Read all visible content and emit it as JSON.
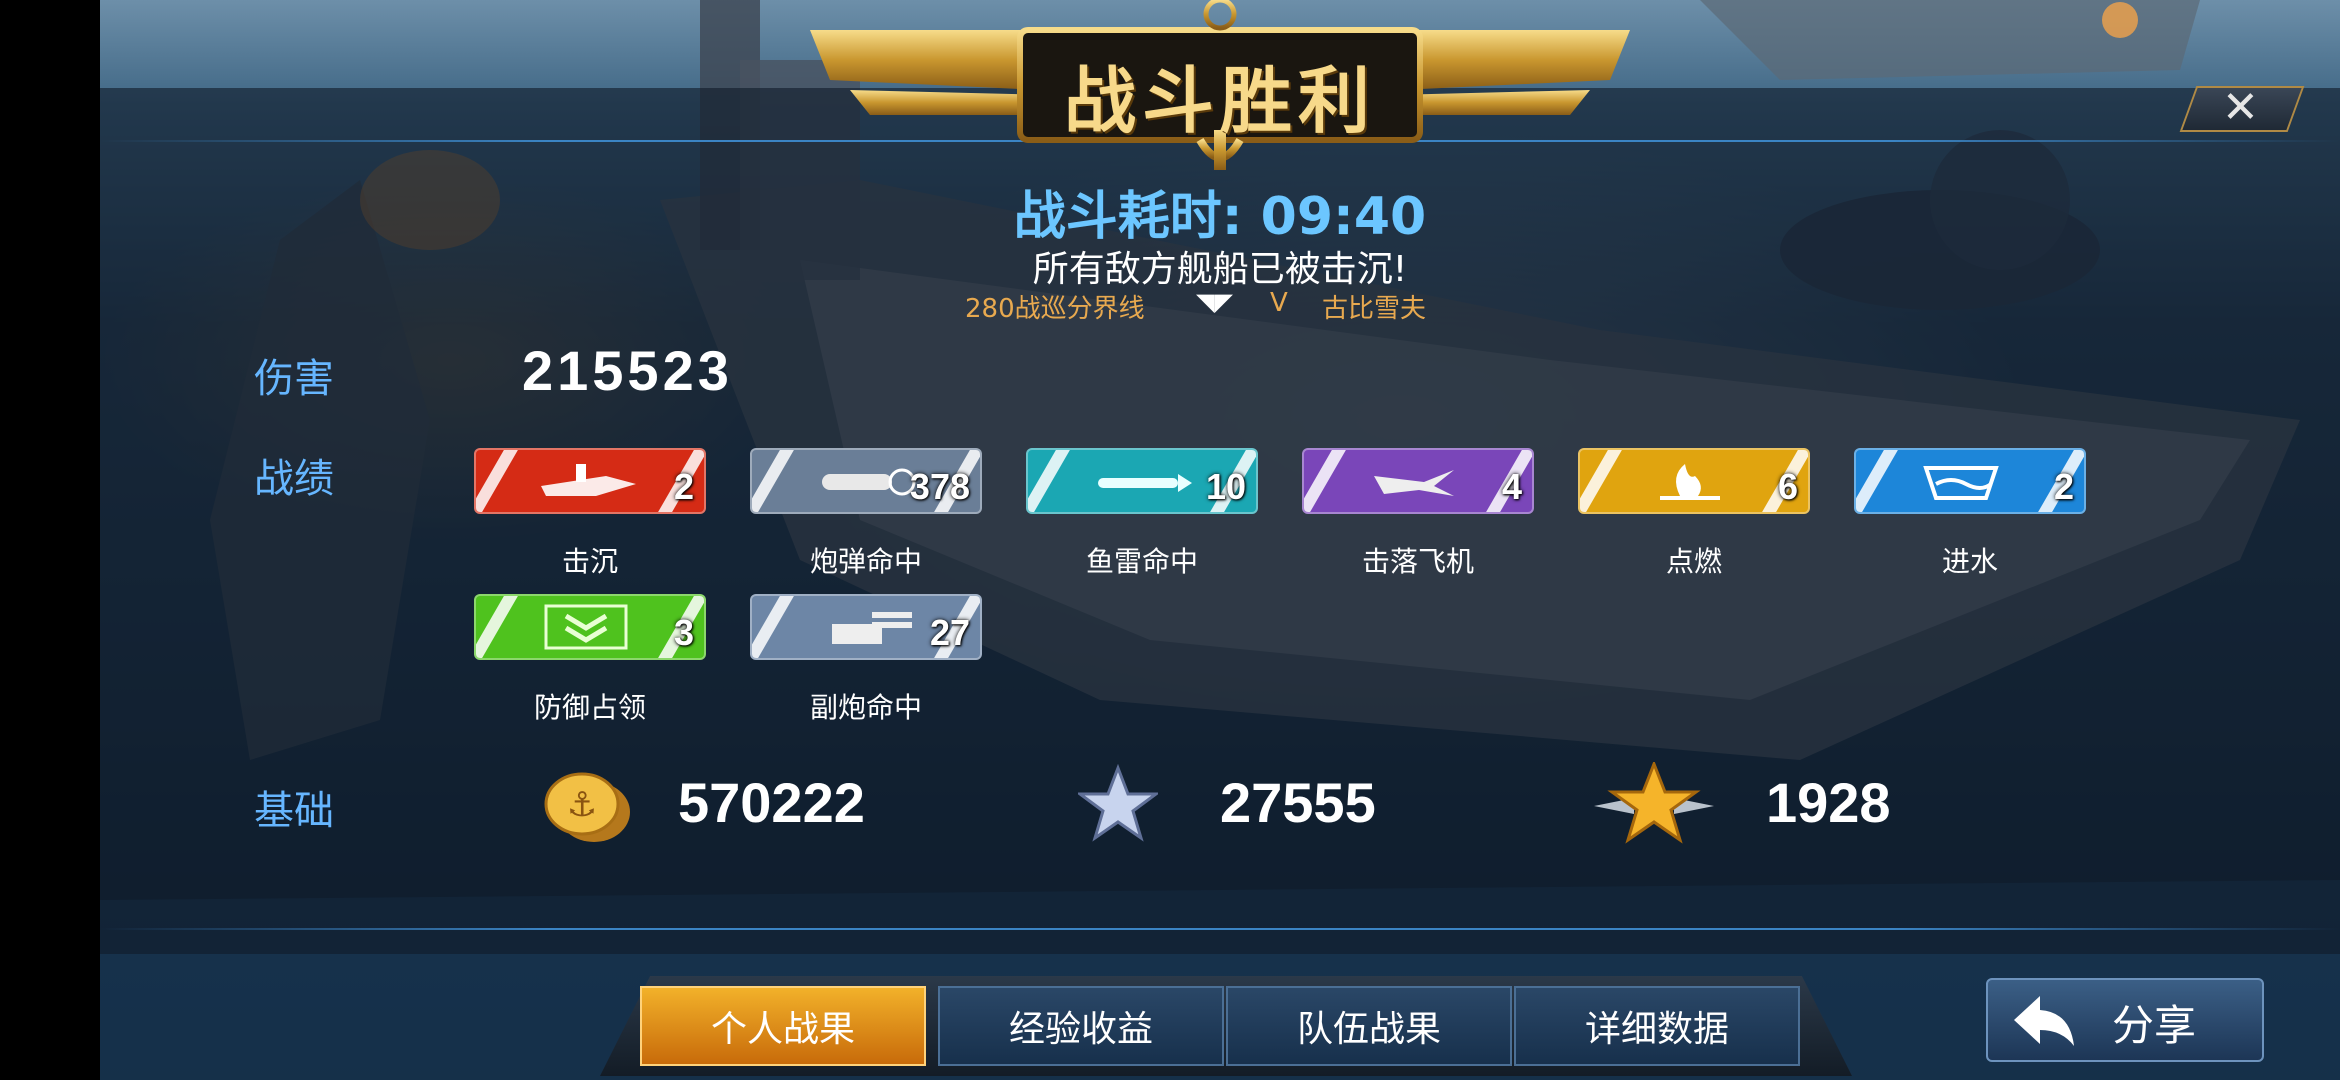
{
  "header": {
    "title": "战斗胜利",
    "duration_label": "战斗耗时: 09:40",
    "message": "所有敌方舰船已被击沉!",
    "match_left": "280战巡分界线",
    "versus": "V",
    "match_right": "古比雪夫"
  },
  "damage": {
    "label": "伤害",
    "value": "215523"
  },
  "record": {
    "label": "战绩",
    "items": [
      {
        "label": "击沉",
        "count": "2",
        "color": "#d52b15",
        "icon": "ship-sink-icon"
      },
      {
        "label": "炮弹命中",
        "count": "378",
        "color": "#6a7e97",
        "icon": "shell-icon"
      },
      {
        "label": "鱼雷命中",
        "count": "10",
        "color": "#1ba7b3",
        "icon": "torpedo-icon"
      },
      {
        "label": "击落飞机",
        "count": "4",
        "color": "#7a46b9",
        "icon": "plane-icon"
      },
      {
        "label": "点燃",
        "count": "6",
        "color": "#e0a40f",
        "icon": "fire-icon"
      },
      {
        "label": "进水",
        "count": "2",
        "color": "#1d86d9",
        "icon": "flood-icon"
      },
      {
        "label": "防御占领",
        "count": "3",
        "color": "#4fc21e",
        "icon": "defense-chevron-icon"
      },
      {
        "label": "副炮命中",
        "count": "27",
        "color": "#6d86a6",
        "icon": "secondary-gun-icon"
      }
    ]
  },
  "base": {
    "label": "基础",
    "coins": "570222",
    "stars": "27555",
    "rank_points": "1928"
  },
  "tabs": [
    {
      "label": "个人战果",
      "active": true
    },
    {
      "label": "经验收益",
      "active": false
    },
    {
      "label": "队伍战果",
      "active": false
    },
    {
      "label": "详细数据",
      "active": false
    }
  ],
  "share_label": "分享",
  "colors": {
    "accent_label": "#66b6ff",
    "tab_active": "#f2b12a",
    "gold": "#e9b54a"
  }
}
